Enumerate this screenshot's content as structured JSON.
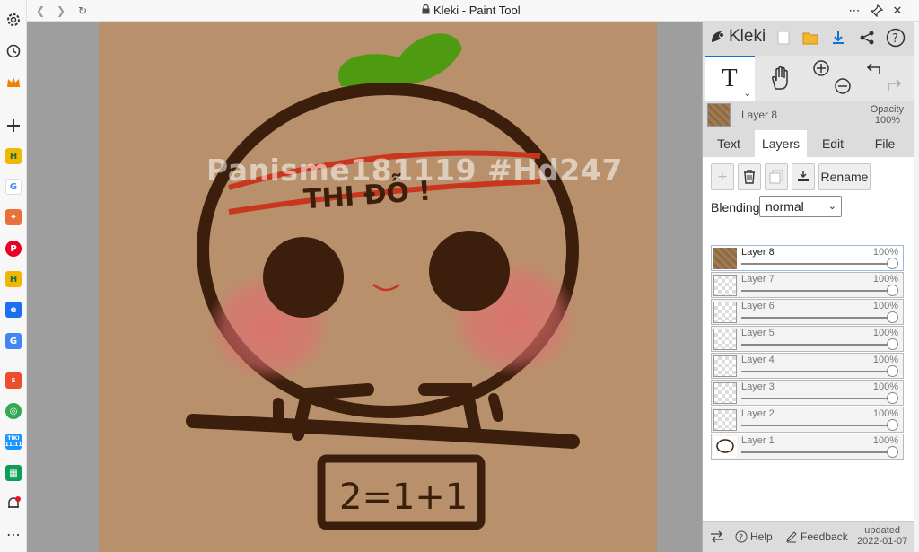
{
  "window": {
    "title": "Kleki - Paint Tool"
  },
  "edge_sidebar": {
    "items": [
      "settings-icon",
      "history-icon",
      "crown-icon",
      "add-icon",
      "h-app-icon",
      "google-icon",
      "shield-app-icon",
      "pinterest-icon",
      "h-app-icon",
      "blue-app-icon",
      "translate-icon",
      "shopee-icon",
      "green-app-icon",
      "tiki-icon",
      "sheets-icon",
      "notifications-icon",
      "more-icon"
    ],
    "tiki_label": "TIKI\n11.11",
    "shopee_label": "TET"
  },
  "canvas": {
    "background": "#b8916c",
    "watermark": "Panisme181119 #Hd247",
    "headband_text": "THI ĐỖ !",
    "sign_text": "2=1+1"
  },
  "panel": {
    "logo_text": "Kleki",
    "header_icons": [
      "new-image-icon",
      "open-folder-icon",
      "download-icon",
      "share-icon",
      "help-icon"
    ],
    "tools": [
      "text-tool",
      "hand-tool",
      "zoom-in",
      "zoom-out",
      "undo",
      "redo"
    ],
    "current_layer": {
      "name": "Layer 8",
      "opacity_label": "Opacity",
      "opacity_value": "100%"
    },
    "tabs": [
      "Text",
      "Layers",
      "Edit",
      "File"
    ],
    "active_tab": "Layers",
    "layer_tools": {
      "rename_label": "Rename"
    },
    "blending_label": "Blending",
    "blending_value": "normal",
    "layers": [
      {
        "name": "Layer 8",
        "opacity": "100%",
        "selected": true
      },
      {
        "name": "Layer 7",
        "opacity": "100%",
        "selected": false
      },
      {
        "name": "Layer 6",
        "opacity": "100%",
        "selected": false
      },
      {
        "name": "Layer 5",
        "opacity": "100%",
        "selected": false
      },
      {
        "name": "Layer 4",
        "opacity": "100%",
        "selected": false
      },
      {
        "name": "Layer 3",
        "opacity": "100%",
        "selected": false
      },
      {
        "name": "Layer 2",
        "opacity": "100%",
        "selected": false
      },
      {
        "name": "Layer 1",
        "opacity": "100%",
        "selected": false
      }
    ],
    "footer": {
      "help_label": "Help",
      "feedback_label": "Feedback",
      "updated_label": "updated",
      "updated_date": "2022-01-07"
    }
  },
  "colors": {
    "accent": "#0a74d6",
    "brown_stroke": "#3b1e0c",
    "sprout_green": "#4e9a10",
    "headband_red": "#c9361e",
    "cheek_pink": "#e57a7a"
  }
}
